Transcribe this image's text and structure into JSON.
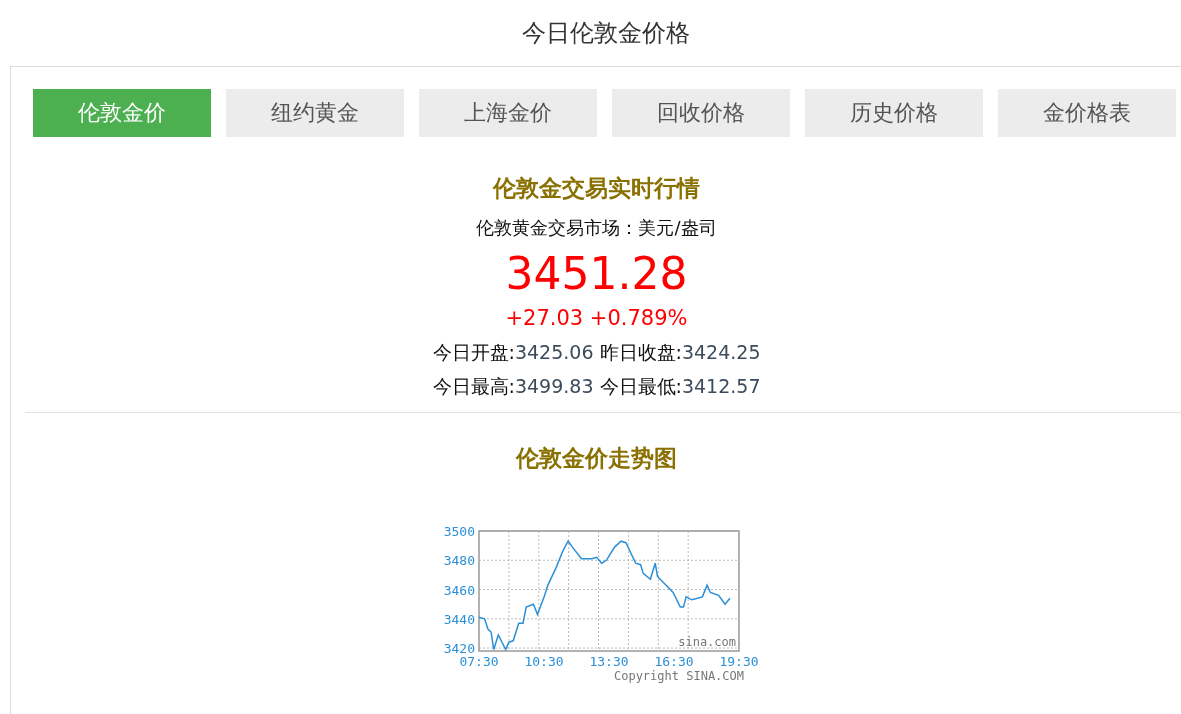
{
  "page_title": "今日伦敦金价格",
  "tabs": [
    {
      "label": "伦敦金价",
      "selected": true
    },
    {
      "label": "纽约黄金",
      "selected": false
    },
    {
      "label": "上海金价",
      "selected": false
    },
    {
      "label": "回收价格",
      "selected": false
    },
    {
      "label": "历史价格",
      "selected": false
    },
    {
      "label": "金价格表",
      "selected": false
    }
  ],
  "quote": {
    "heading": "伦敦金交易实时行情",
    "market": "伦敦黄金交易市场：美元/盎司",
    "price": "3451.28",
    "change": "+27.03 +0.789%",
    "stats": [
      [
        {
          "label": "今日开盘:",
          "value": "3425.06"
        },
        {
          "label": "昨日收盘:",
          "value": "3424.25"
        }
      ],
      [
        {
          "label": "今日最高:",
          "value": "3499.83"
        },
        {
          "label": "今日最低:",
          "value": "3412.57"
        }
      ]
    ]
  },
  "trend": {
    "heading": "伦敦金价走势图",
    "source_label": "sina.com",
    "copyright": "Copyright SINA.COM",
    "chart_data": {
      "type": "line",
      "x": [
        7.5,
        7.76,
        7.91,
        8.06,
        8.18,
        8.39,
        8.73,
        8.88,
        9.08,
        9.33,
        9.53,
        9.68,
        10.01,
        10.2,
        10.53,
        10.68,
        11.06,
        11.36,
        11.61,
        11.81,
        12.23,
        12.71,
        12.93,
        13.16,
        13.38,
        13.76,
        14.06,
        14.28,
        14.73,
        14.96,
        15.08,
        15.41,
        15.63,
        15.74,
        16.46,
        16.79,
        16.94,
        17.06,
        17.33,
        17.81,
        18.03,
        18.18,
        18.56,
        18.86,
        19.08
      ],
      "series": [
        {
          "color": "#2a8fd8",
          "values": [
            3441,
            3440,
            3433,
            3431,
            3419,
            3429,
            3419,
            3424,
            3425,
            3437,
            3437,
            3448,
            3450,
            3443,
            3456,
            3463,
            3475,
            3486,
            3493,
            3489,
            3481,
            3481,
            3482,
            3478,
            3480,
            3489,
            3493,
            3492,
            3478,
            3477,
            3471,
            3467,
            3478,
            3469,
            3458,
            3448,
            3448,
            3455,
            3453,
            3455,
            3463,
            3458,
            3456,
            3450,
            3454
          ]
        }
      ],
      "grid": true,
      "xlim": [
        7.5,
        19.5
      ],
      "ylim": [
        3418,
        3500
      ],
      "xticks": [
        {
          "value": 7.5,
          "label": "07:30"
        },
        {
          "value": 10.5,
          "label": "10:30"
        },
        {
          "value": 13.5,
          "label": "13:30"
        },
        {
          "value": 16.5,
          "label": "16:30"
        },
        {
          "value": 19.5,
          "label": "19:30"
        }
      ],
      "yticks": [
        3420,
        3440,
        3460,
        3480,
        3500
      ]
    }
  }
}
